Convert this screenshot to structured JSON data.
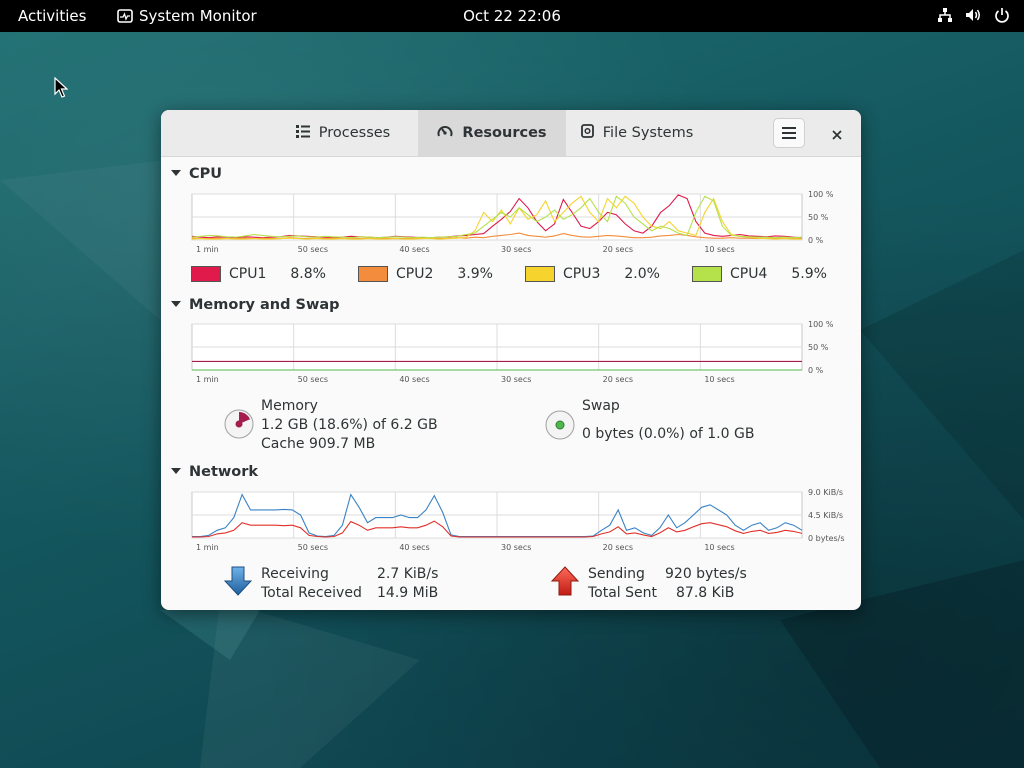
{
  "topbar": {
    "activities": "Activities",
    "app_name": "System Monitor",
    "clock": "Oct 22  22:06"
  },
  "tabs": [
    {
      "label": "Processes",
      "icon": "list-icon",
      "active": false
    },
    {
      "label": "Resources",
      "icon": "gauge-icon",
      "active": true
    },
    {
      "label": "File Systems",
      "icon": "disk-icon",
      "active": false
    }
  ],
  "sections": {
    "cpu": "CPU",
    "memory": "Memory and Swap",
    "network": "Network"
  },
  "time_axis": [
    "1 min",
    "50 secs",
    "40 secs",
    "30 secs",
    "20 secs",
    "10 secs"
  ],
  "percent_axis": [
    "100 %",
    "50 %",
    "0 %"
  ],
  "network_axis": [
    "9.0 KiB/s",
    "4.5 KiB/s",
    "0 bytes/s"
  ],
  "cpu_legend": [
    {
      "name": "CPU1",
      "value": "8.8%",
      "color": "#e01b4c"
    },
    {
      "name": "CPU2",
      "value": "3.9%",
      "color": "#f38c3c"
    },
    {
      "name": "CPU3",
      "value": "2.0%",
      "color": "#f6d32d"
    },
    {
      "name": "CPU4",
      "value": "5.9%",
      "color": "#b5e14b"
    }
  ],
  "memory": {
    "label": "Memory",
    "usage": "1.2 GB (18.6%) of 6.2 GB",
    "cache": "Cache 909.7 MB",
    "fraction": 0.186,
    "color": "#a51d4e"
  },
  "swap": {
    "label": "Swap",
    "usage": "0 bytes (0.0%) of 1.0 GB",
    "fraction": 0.0,
    "color": "#4eb84e"
  },
  "network": {
    "receiving_label": "Receiving",
    "receiving_value": "2.7 KiB/s",
    "total_received_label": "Total Received",
    "total_received_value": "14.9 MiB",
    "sending_label": "Sending",
    "sending_value": "920 bytes/s",
    "total_sent_label": "Total Sent",
    "total_sent_value": "87.8 KiB",
    "receive_color": "#3a82c4",
    "send_color": "#e0302a"
  },
  "chart_data": [
    {
      "type": "line",
      "name": "CPU History",
      "ylim": [
        0,
        100
      ],
      "series": [
        {
          "name": "CPU1",
          "color": "#e01b4c",
          "values": [
            8,
            6,
            5,
            7,
            6,
            5,
            7,
            6,
            5,
            6,
            7,
            10,
            9,
            8,
            7,
            6,
            5,
            6,
            8,
            7,
            6,
            5,
            6,
            8,
            7,
            6,
            5,
            5,
            6,
            7,
            9,
            10,
            12,
            14,
            30,
            45,
            62,
            90,
            70,
            40,
            20,
            35,
            88,
            60,
            30,
            25,
            40,
            60,
            55,
            35,
            20,
            15,
            30,
            60,
            75,
            98,
            90,
            40,
            15,
            10,
            8,
            10,
            12,
            9,
            8,
            7,
            9,
            8,
            6,
            5
          ]
        },
        {
          "name": "CPU2",
          "color": "#f38c3c",
          "values": [
            4,
            3,
            3,
            4,
            3,
            3,
            4,
            3,
            4,
            3,
            3,
            5,
            4,
            3,
            4,
            3,
            4,
            3,
            4,
            3,
            4,
            3,
            4,
            3,
            3,
            4,
            3,
            4,
            3,
            4,
            5,
            4,
            6,
            5,
            8,
            10,
            12,
            15,
            10,
            8,
            6,
            9,
            14,
            10,
            7,
            6,
            8,
            10,
            9,
            7,
            5,
            5,
            6,
            9,
            10,
            12,
            10,
            7,
            5,
            4,
            4,
            5,
            4,
            4,
            3,
            4,
            4,
            3,
            4,
            3
          ]
        },
        {
          "name": "CPU3",
          "color": "#f6d32d",
          "values": [
            2,
            3,
            2,
            2,
            3,
            2,
            2,
            3,
            2,
            2,
            3,
            4,
            3,
            2,
            3,
            2,
            2,
            3,
            2,
            2,
            3,
            2,
            2,
            3,
            2,
            2,
            3,
            3,
            2,
            3,
            4,
            6,
            20,
            60,
            40,
            65,
            35,
            70,
            45,
            55,
            85,
            40,
            60,
            80,
            95,
            60,
            40,
            90,
            70,
            95,
            80,
            50,
            30,
            25,
            40,
            20,
            15,
            10,
            60,
            90,
            40,
            12,
            8,
            6,
            4,
            3,
            2,
            3,
            2,
            2
          ]
        },
        {
          "name": "CPU4",
          "color": "#b5e14b",
          "values": [
            6,
            8,
            10,
            9,
            7,
            6,
            9,
            12,
            10,
            8,
            7,
            8,
            9,
            7,
            6,
            8,
            7,
            6,
            5,
            7,
            6,
            5,
            6,
            7,
            6,
            5,
            6,
            5,
            6,
            7,
            8,
            12,
            15,
            30,
            45,
            60,
            50,
            70,
            55,
            40,
            50,
            65,
            45,
            55,
            70,
            90,
            60,
            40,
            95,
            80,
            50,
            35,
            20,
            30,
            25,
            15,
            10,
            60,
            95,
            85,
            30,
            10,
            8,
            7,
            6,
            6,
            5,
            6,
            5,
            6
          ]
        }
      ]
    },
    {
      "type": "line",
      "name": "Memory and Swap History",
      "ylim": [
        0,
        100
      ],
      "series": [
        {
          "name": "Memory",
          "color": "#a51d4e",
          "values": [
            18.6,
            18.6,
            18.6,
            18.6,
            18.6,
            18.6,
            18.6,
            18.6,
            18.6,
            18.6,
            18.6,
            18.6,
            18.6,
            18.6,
            18.6,
            18.6,
            18.6,
            18.6,
            18.6,
            18.6
          ]
        },
        {
          "name": "Swap",
          "color": "#4eb84e",
          "values": [
            0,
            0,
            0,
            0,
            0,
            0,
            0,
            0,
            0,
            0,
            0,
            0,
            0,
            0,
            0,
            0,
            0,
            0,
            0,
            0
          ]
        }
      ]
    },
    {
      "type": "line",
      "name": "Network History",
      "ylim": [
        0,
        9.0
      ],
      "yunit": "KiB/s",
      "series": [
        {
          "name": "Receiving",
          "color": "#3a82c4",
          "values": [
            0.3,
            0.3,
            0.5,
            1.5,
            2.0,
            4.0,
            8.5,
            5.5,
            5.5,
            5.5,
            5.5,
            5.6,
            5.5,
            4.5,
            1.0,
            0.4,
            0.3,
            0.5,
            2.5,
            8.5,
            6.0,
            3.0,
            4.0,
            4.0,
            4.0,
            4.5,
            4.0,
            4.0,
            5.5,
            8.3,
            5.0,
            0.6,
            0.3,
            0.3,
            0.3,
            0.3,
            0.3,
            0.3,
            0.3,
            0.3,
            0.3,
            0.3,
            0.3,
            0.3,
            0.3,
            0.3,
            0.3,
            0.3,
            0.4,
            1.5,
            2.5,
            5.5,
            1.5,
            2.0,
            1.0,
            0.5,
            2.0,
            4.5,
            2.0,
            3.0,
            4.5,
            6.0,
            6.5,
            5.5,
            4.5,
            2.5,
            1.5,
            2.5,
            3.0,
            1.5,
            2.0,
            3.0,
            2.5,
            1.5
          ]
        },
        {
          "name": "Sending",
          "color": "#e0302a",
          "values": [
            0.2,
            0.2,
            0.3,
            0.8,
            1.0,
            1.5,
            3.0,
            2.5,
            2.5,
            2.5,
            2.5,
            2.4,
            2.5,
            2.0,
            0.5,
            0.3,
            0.2,
            0.3,
            1.0,
            3.2,
            2.5,
            1.5,
            2.0,
            2.0,
            2.0,
            2.2,
            2.0,
            2.0,
            2.5,
            3.3,
            2.2,
            0.4,
            0.2,
            0.2,
            0.2,
            0.2,
            0.2,
            0.2,
            0.2,
            0.2,
            0.2,
            0.2,
            0.2,
            0.2,
            0.2,
            0.2,
            0.2,
            0.2,
            0.3,
            0.8,
            1.2,
            2.2,
            0.8,
            1.0,
            0.6,
            0.3,
            1.0,
            2.0,
            1.2,
            1.5,
            2.2,
            2.8,
            3.0,
            2.6,
            2.2,
            1.4,
            0.9,
            1.3,
            1.5,
            0.9,
            1.1,
            1.5,
            1.3,
            0.9
          ]
        }
      ]
    }
  ]
}
